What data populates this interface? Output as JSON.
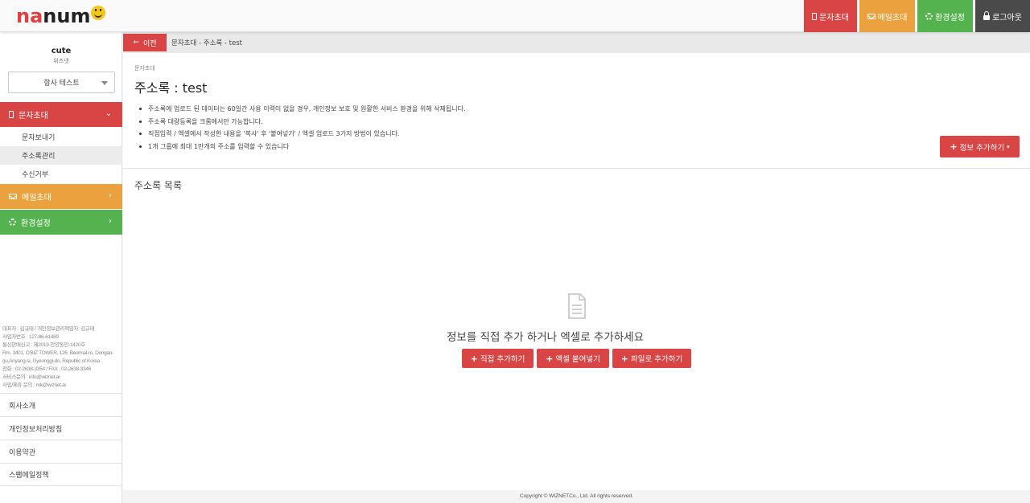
{
  "brand": {
    "logo_text": "nanume"
  },
  "topnav": {
    "sms": "문자초대",
    "mail": "메일초대",
    "settings": "환경설정",
    "logout": "로그아웃"
  },
  "sidebar": {
    "user_name": "cute",
    "user_sub": "위즈넷",
    "project_select": "항사 테스트",
    "menu_sms": "문자초대",
    "sub_items": [
      "문자보내기",
      "주소록관리",
      "수신거부"
    ],
    "menu_mail": "메일초대",
    "menu_settings": "환경설정",
    "company_info": [
      "대표자 : 김규태 / 개인정보관리책임자: 김규태",
      "사업자번호 : 127-86-61489",
      "통신판매신고 : 제2019-안양동안-1420호",
      "Rm. 3401, O'BIZ TOWER, 126, Beolmal-ro, Dongan-gu,Anyang-si, Gyeonggi-do, Republic of Korea",
      "전화 : 02-2638-3354 / FAX : 02-2638-3346",
      "서비스문의 : info@wiznet.ai",
      "사업/제휴 문의 : mk@wiznet.ai"
    ],
    "footer_links": [
      "회사소개",
      "개인정보처리방침",
      "이용약관",
      "스팸메일정책"
    ]
  },
  "crumbbar": {
    "back_label": "이전",
    "crumb": "문자초대 - 주소록 - test"
  },
  "main": {
    "section_small": "문자초대",
    "title": "주소록 : test",
    "notes": [
      "주소록에 업로드 된 데이터는 60일간 사용 이력이 없을 경우, 개인정보 보호 및 원활한 서비스 환경을 위해 삭제됩니다.",
      "주소록 대량등록을 크롬에서만 가능합니다.",
      "직접입력 / 엑셀에서 작성한 내용을 '복사' 후 '붙여넣기' / 엑셀 업로드 3가지 방법이 있습니다.",
      "1개 그룹에 최대 1만개의 주소를 입력할 수 있습니다"
    ],
    "add_info_button": "정보 추가하기",
    "list_title": "주소록 목록",
    "empty_text": "정보를 직접 추가 하거나 엑셀로 추가하세요",
    "buttons": {
      "direct": "직접 추가하기",
      "excel_paste": "엑셀 붙여넣기",
      "file": "파일로 추가하기"
    }
  },
  "copyright": "Copyright © WIZNETCo., Ltd. All rights reserved.",
  "colors": {
    "red": "#d94545",
    "orange": "#eba13e",
    "green": "#55b34f",
    "dark": "#4a4a4a"
  }
}
